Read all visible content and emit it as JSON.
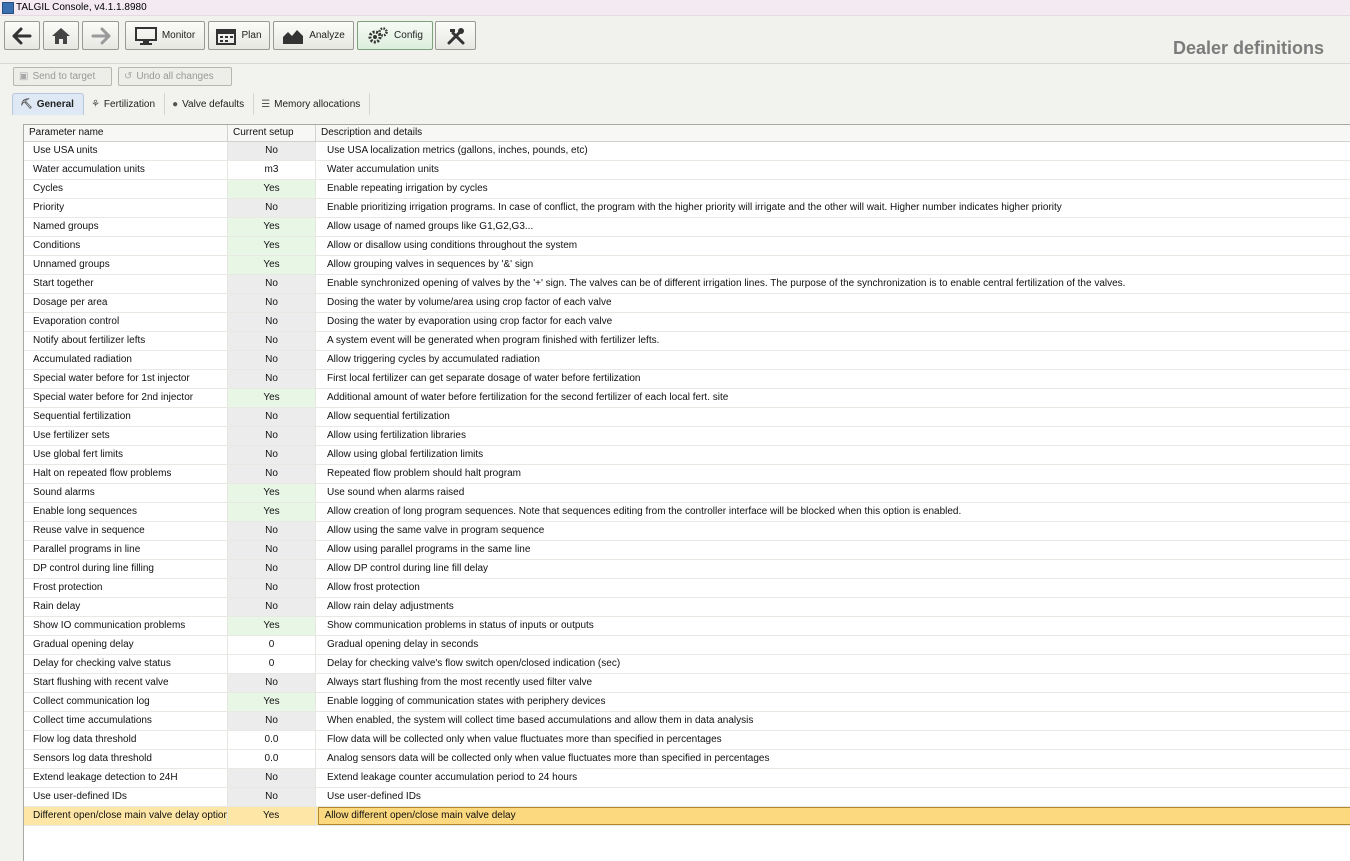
{
  "window": {
    "title": "TALGIL Console, v4.1.1.8980"
  },
  "toolbar": {
    "back_label": "",
    "home_label": "",
    "forward_label": "",
    "monitor_label": "Monitor",
    "plan_label": "Plan",
    "analyze_label": "Analyze",
    "config_label": "Config",
    "tools_label": ""
  },
  "page_title": "Dealer definitions",
  "actions": {
    "send_label": "Send to target",
    "undo_label": "Undo all changes"
  },
  "tabs": [
    {
      "label": "General",
      "icon": "general-icon"
    },
    {
      "label": "Fertilization",
      "icon": "fertilization-icon"
    },
    {
      "label": "Valve defaults",
      "icon": "drop-icon"
    },
    {
      "label": "Memory allocations",
      "icon": "list-icon"
    }
  ],
  "grid": {
    "headers": [
      "Parameter name",
      "Current setup",
      "Description and details"
    ],
    "rows": [
      {
        "name": "Use USA units",
        "value": "No",
        "desc": "Use USA localization metrics (gallons, inches, pounds, etc)"
      },
      {
        "name": "Water accumulation units",
        "value": "m3",
        "desc": "Water accumulation units"
      },
      {
        "name": "Cycles",
        "value": "Yes",
        "desc": "Enable repeating irrigation by cycles"
      },
      {
        "name": "Priority",
        "value": "No",
        "desc": "Enable prioritizing irrigation programs. In case of conflict, the program with the higher priority will irrigate and the other will wait. Higher number indicates higher priority"
      },
      {
        "name": "Named groups",
        "value": "Yes",
        "desc": "Allow usage of named groups like G1,G2,G3..."
      },
      {
        "name": "Conditions",
        "value": "Yes",
        "desc": "Allow or disallow using conditions throughout the system"
      },
      {
        "name": "Unnamed groups",
        "value": "Yes",
        "desc": "Allow grouping valves in sequences by '&' sign"
      },
      {
        "name": "Start together",
        "value": "No",
        "desc": "Enable synchronized opening of valves by the '+' sign. The valves can be of different irrigation lines. The purpose of the synchronization is to enable central fertilization of the valves."
      },
      {
        "name": "Dosage per area",
        "value": "No",
        "desc": "Dosing the water by volume/area using crop factor of each valve"
      },
      {
        "name": "Evaporation control",
        "value": "No",
        "desc": "Dosing the water by evaporation using crop factor for each valve"
      },
      {
        "name": "Notify about fertilizer lefts",
        "value": "No",
        "desc": "A system event will be generated when program finished with fertilizer lefts."
      },
      {
        "name": "Accumulated radiation",
        "value": "No",
        "desc": "Allow triggering cycles by accumulated radiation"
      },
      {
        "name": "Special water before for 1st injector",
        "value": "No",
        "desc": "First local fertilizer can get separate dosage of water before fertilization"
      },
      {
        "name": "Special water before for 2nd injector",
        "value": "Yes",
        "desc": "Additional amount of water before fertilization for the second fertilizer of each local fert. site"
      },
      {
        "name": "Sequential fertilization",
        "value": "No",
        "desc": "Allow sequential fertilization"
      },
      {
        "name": "Use fertilizer sets",
        "value": "No",
        "desc": "Allow using fertilization libraries"
      },
      {
        "name": "Use global fert limits",
        "value": "No",
        "desc": "Allow using global fertilization limits"
      },
      {
        "name": "Halt on repeated flow problems",
        "value": "No",
        "desc": "Repeated flow problem should halt program"
      },
      {
        "name": "Sound alarms",
        "value": "Yes",
        "desc": "Use sound when alarms raised"
      },
      {
        "name": "Enable long sequences",
        "value": "Yes",
        "desc": "Allow creation of long program sequences. Note that sequences editing from the controller interface will be blocked when this option is enabled."
      },
      {
        "name": "Reuse valve in sequence",
        "value": "No",
        "desc": "Allow using the same valve in program sequence"
      },
      {
        "name": "Parallel programs in line",
        "value": "No",
        "desc": "Allow using parallel programs in the same line"
      },
      {
        "name": "DP control during line filling",
        "value": "No",
        "desc": "Allow DP control during line fill delay"
      },
      {
        "name": "Frost protection",
        "value": "No",
        "desc": "Allow frost protection"
      },
      {
        "name": "Rain delay",
        "value": "No",
        "desc": "Allow rain delay adjustments"
      },
      {
        "name": "Show IO communication problems",
        "value": "Yes",
        "desc": "Show communication problems in status of inputs or outputs"
      },
      {
        "name": "Gradual opening delay",
        "value": "0",
        "desc": "Gradual opening delay in seconds"
      },
      {
        "name": "Delay for checking valve status",
        "value": "0",
        "desc": "Delay for checking valve's flow switch open/closed indication (sec)"
      },
      {
        "name": "Start flushing with recent valve",
        "value": "No",
        "desc": "Always start flushing from the most recently used filter valve"
      },
      {
        "name": "Collect communication log",
        "value": "Yes",
        "desc": "Enable logging of communication states with periphery devices"
      },
      {
        "name": "Collect time accumulations",
        "value": "No",
        "desc": "When enabled, the system will collect time based accumulations and allow them in data analysis"
      },
      {
        "name": "Flow log data threshold",
        "value": "0.0",
        "desc": "Flow data will be collected only when value fluctuates more than specified in percentages"
      },
      {
        "name": "Sensors log data threshold",
        "value": "0.0",
        "desc": "Analog sensors data will be collected only when value fluctuates more than specified in percentages"
      },
      {
        "name": "Extend leakage detection to 24H",
        "value": "No",
        "desc": "Extend leakage counter accumulation period to 24 hours"
      },
      {
        "name": "Use user-defined IDs",
        "value": "No",
        "desc": "Use user-defined IDs"
      },
      {
        "name": "Different open/close main valve delay option",
        "value": "Yes",
        "desc": "Allow different open/close main valve delay"
      }
    ]
  }
}
